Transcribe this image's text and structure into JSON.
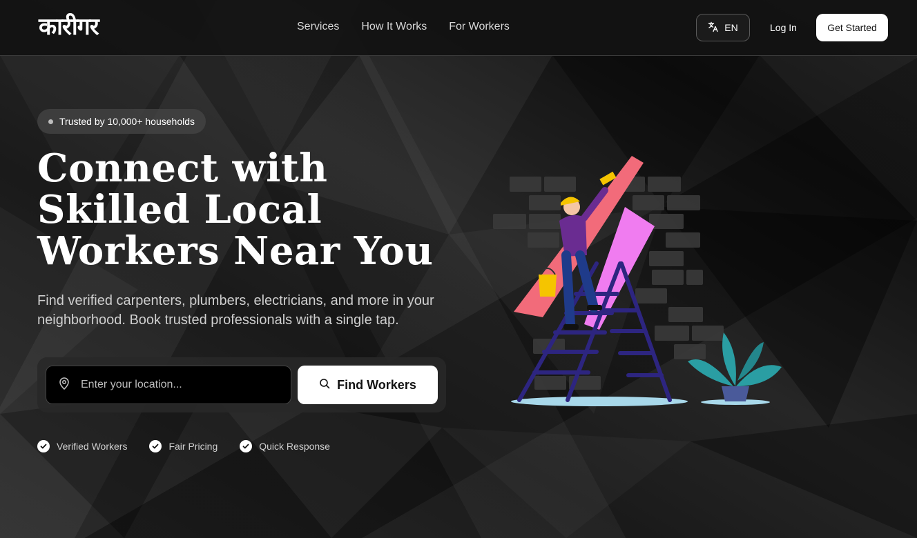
{
  "brand": {
    "logo_text": "कारीगर"
  },
  "nav": {
    "items": [
      {
        "label": "Services"
      },
      {
        "label": "How It Works"
      },
      {
        "label": "For Workers"
      }
    ]
  },
  "header": {
    "lang_label": "EN",
    "login_label": "Log In",
    "cta_label": "Get Started"
  },
  "hero": {
    "badge": "Trusted by 10,000+ households",
    "title_line1": "Connect with",
    "title_line2": "Skilled Local",
    "title_line3": "Workers Near You",
    "subtitle": "Find verified carpenters, plumbers, electricians, and more in your neighborhood. Book trusted professionals with a single tap."
  },
  "search": {
    "placeholder": "Enter your location...",
    "value": "",
    "button_label": "Find Workers"
  },
  "features": [
    {
      "label": "Verified Workers"
    },
    {
      "label": "Fair Pricing"
    },
    {
      "label": "Quick Response"
    }
  ],
  "icons": {
    "translate": "translate-icon",
    "location": "map-pin-icon",
    "search": "search-icon",
    "check": "check-circle-icon"
  },
  "colors": {
    "background": "#141414",
    "accent": "#ffffff",
    "paint_pink": "#f26b7a",
    "paint_magenta": "#f07cf0",
    "ladder": "#2d2580",
    "plant": "#2a9ea3"
  }
}
